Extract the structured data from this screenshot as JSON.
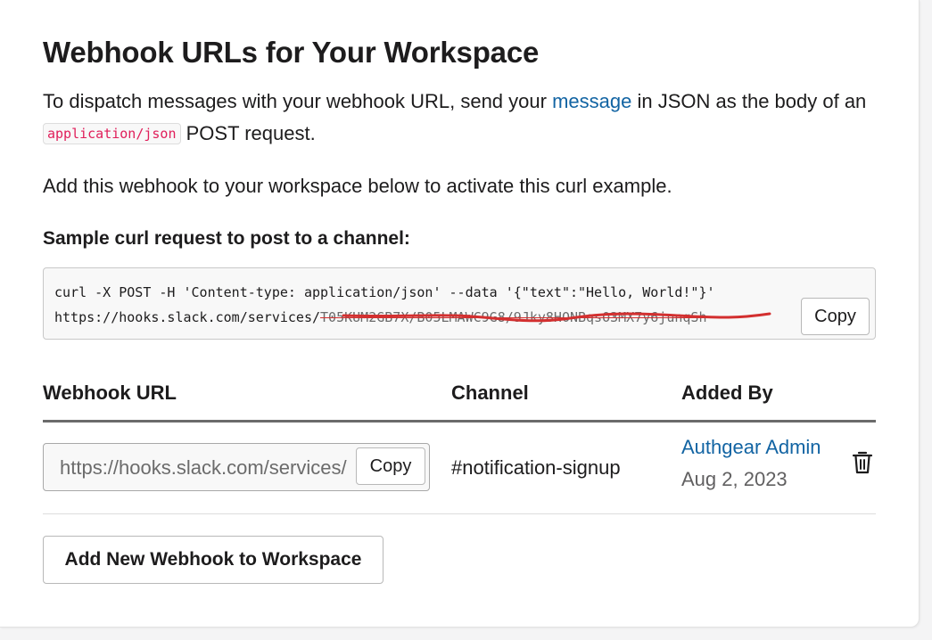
{
  "page": {
    "title": "Webhook URLs for Your Workspace",
    "intro_prefix": "To dispatch messages with your webhook URL, send your ",
    "intro_link": "message",
    "intro_middle": " in JSON as the body of an ",
    "intro_code": "application/json",
    "intro_suffix": " POST request.",
    "activate_text": "Add this webhook to your workspace below to activate this curl example.",
    "sample_label": "Sample curl request to post to a channel:"
  },
  "curl": {
    "line1": "curl -X POST -H 'Content-type: application/json' --data '{\"text\":\"Hello, World!\"}'",
    "line2_prefix": "https://hooks.slack.com/services/",
    "line2_redacted": "T05KUM2GB7X/B05LMAWC9G8/9Jky8HONBqsO3MX7y6junqSh",
    "copy_label": "Copy"
  },
  "table": {
    "headers": [
      "Webhook URL",
      "Channel",
      "Added By"
    ],
    "rows": [
      {
        "url": "https://hooks.slack.com/services/",
        "copy_label": "Copy",
        "channel": "#notification-signup",
        "added_by": "Authgear Admin",
        "date": "Aug 2, 2023",
        "delete_icon": "trash-icon"
      }
    ]
  },
  "add_button_label": "Add New Webhook to Workspace",
  "colors": {
    "link": "#1264a3",
    "inline_code": "#e01e5a",
    "redaction": "#d32f2f"
  }
}
